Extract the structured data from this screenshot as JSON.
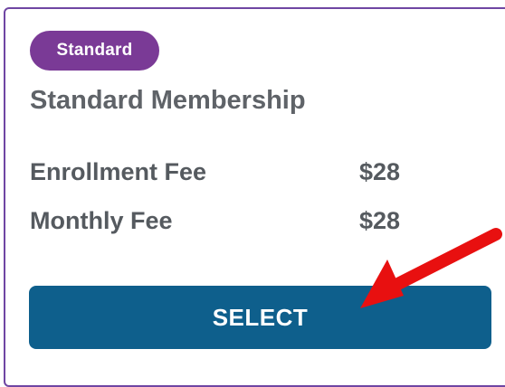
{
  "card": {
    "badge_label": "Standard",
    "title": "Standard Membership",
    "fees": [
      {
        "label": "Enrollment Fee",
        "value": "$28"
      },
      {
        "label": "Monthly Fee",
        "value": "$28"
      }
    ],
    "select_label": "SELECT"
  },
  "colors": {
    "card_border": "#6f46a3",
    "badge_bg": "#7a3a96",
    "button_bg": "#0e5f8c",
    "text": "#555a5f",
    "annotation_arrow": "#e81010"
  },
  "icons": {
    "annotation": "red-arrow-icon"
  }
}
